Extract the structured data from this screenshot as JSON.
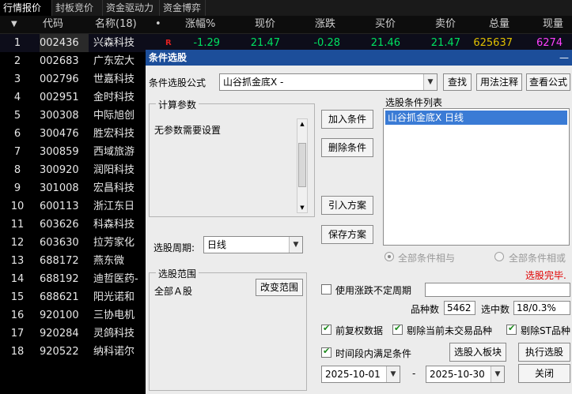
{
  "tabs": [
    {
      "label": "行情报价",
      "active": true
    },
    {
      "label": "封板竞价",
      "active": false
    },
    {
      "label": "资金驱动力",
      "active": false
    },
    {
      "label": "资金博弈",
      "active": false
    }
  ],
  "table_header": {
    "sort_icon": "▼",
    "code": "代码",
    "name": "名称(18)",
    "dot": "•",
    "change_pct": "涨幅%",
    "price": "现价",
    "change": "涨跌",
    "bid": "买价",
    "ask": "卖价",
    "volume": "总量",
    "cur_vol": "现量"
  },
  "first_row": {
    "badge": "R",
    "change_pct": "-1.29",
    "price": "21.47",
    "change": "-0.28",
    "bid": "21.46",
    "ask": "21.47",
    "volume": "625637",
    "cur_vol": "6274"
  },
  "rows": [
    {
      "num": "1",
      "code": "002436",
      "name": "兴森科技"
    },
    {
      "num": "2",
      "code": "002683",
      "name": "广东宏大"
    },
    {
      "num": "3",
      "code": "002796",
      "name": "世嘉科技"
    },
    {
      "num": "4",
      "code": "002951",
      "name": "金时科技"
    },
    {
      "num": "5",
      "code": "300308",
      "name": "中际旭创"
    },
    {
      "num": "6",
      "code": "300476",
      "name": "胜宏科技"
    },
    {
      "num": "7",
      "code": "300859",
      "name": "西域旅游"
    },
    {
      "num": "8",
      "code": "300920",
      "name": "润阳科技"
    },
    {
      "num": "9",
      "code": "301008",
      "name": "宏昌科技"
    },
    {
      "num": "10",
      "code": "600113",
      "name": "浙江东日"
    },
    {
      "num": "11",
      "code": "603626",
      "name": "科森科技"
    },
    {
      "num": "12",
      "code": "603630",
      "name": "拉芳家化"
    },
    {
      "num": "13",
      "code": "688172",
      "name": "燕东微"
    },
    {
      "num": "14",
      "code": "688192",
      "name": "迪哲医药-"
    },
    {
      "num": "15",
      "code": "688621",
      "name": "阳光诺和"
    },
    {
      "num": "16",
      "code": "920100",
      "name": "三协电机"
    },
    {
      "num": "17",
      "code": "920284",
      "name": "灵鸽科技"
    },
    {
      "num": "18",
      "code": "920522",
      "name": "纳科诺尔"
    }
  ],
  "dialog": {
    "title": "条件选股",
    "title_ctrl": "—",
    "formula_label": "条件选股公式",
    "formula_value": "山谷抓金底X  -",
    "find_btn": "查找",
    "usage_btn": "用法注释",
    "view_formula_btn": "查看公式",
    "params_group": "计算参数",
    "params_text": "无参数需要设置",
    "add_cond_btn": "加入条件",
    "del_cond_btn": "删除条件",
    "import_plan_btn": "引入方案",
    "save_plan_btn": "保存方案",
    "cond_list_label": "选股条件列表",
    "cond_items": [
      "山谷抓金底X  日线"
    ],
    "period_label": "选股周期:",
    "period_value": "日线",
    "radio_and": "全部条件相与",
    "radio_or": "全部条件相或",
    "status": "选股完毕.",
    "scope_group": "选股范围",
    "scope_value": "全部Ａ股",
    "change_scope_btn": "改变范围",
    "use_rise_period": "使用涨跌不定周期",
    "count_label": "品种数",
    "count_value": "5462",
    "selected_label": "选中数",
    "selected_value": "18/0.3%",
    "opt_fq": "前复权数据",
    "opt_exclude_nontrade": "剔除当前未交易品种",
    "opt_exclude_st": "剔除ST品种",
    "opt_time_range": "时间段内满足条件",
    "to_block_btn": "选股入板块",
    "execute_btn": "执行选股",
    "date_from": "2025-10-01",
    "date_sep": "-",
    "date_to": "2025-10-30",
    "close_btn": "关闭"
  },
  "colors": {
    "up": "#00e060",
    "vol": "#e0c000",
    "curvol": "#ff40ff",
    "title_bar": "#1c4e9a",
    "status_red": "#e00000"
  }
}
